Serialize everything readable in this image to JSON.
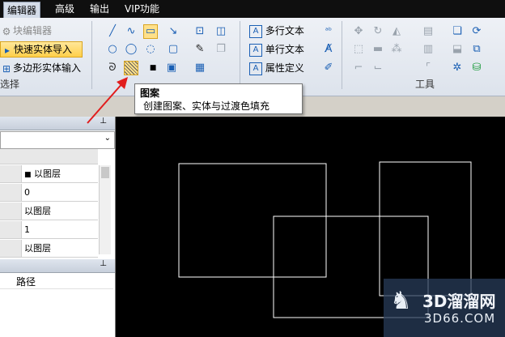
{
  "menubar": {
    "items": [
      "编辑器",
      "高级",
      "输出",
      "VIP功能"
    ]
  },
  "ribbon": {
    "select_group": {
      "items": [
        "块编辑器",
        "快速实体导入",
        "多边形实体输入"
      ],
      "label": "选择"
    },
    "text_group": {
      "items": [
        "多行文本",
        "单行文本",
        "属性定义"
      ]
    },
    "tools_group": {
      "label": "工具"
    }
  },
  "tooltip": {
    "title": "图案",
    "description": "创建图案、实体与过渡色填充"
  },
  "properties_panel": {
    "rows": [
      "以图层",
      "0",
      "以图层",
      "1",
      "以图层"
    ]
  },
  "lower_panel": {
    "column_header": "路径"
  },
  "watermark": {
    "text": "3D溜溜网",
    "subtext": "3D66.COM"
  },
  "colors": {
    "menu_bg": "#0f0f0f",
    "canvas_bg": "#000000",
    "arrow": "#e11d1d",
    "highlight": "#ffcf4a"
  }
}
